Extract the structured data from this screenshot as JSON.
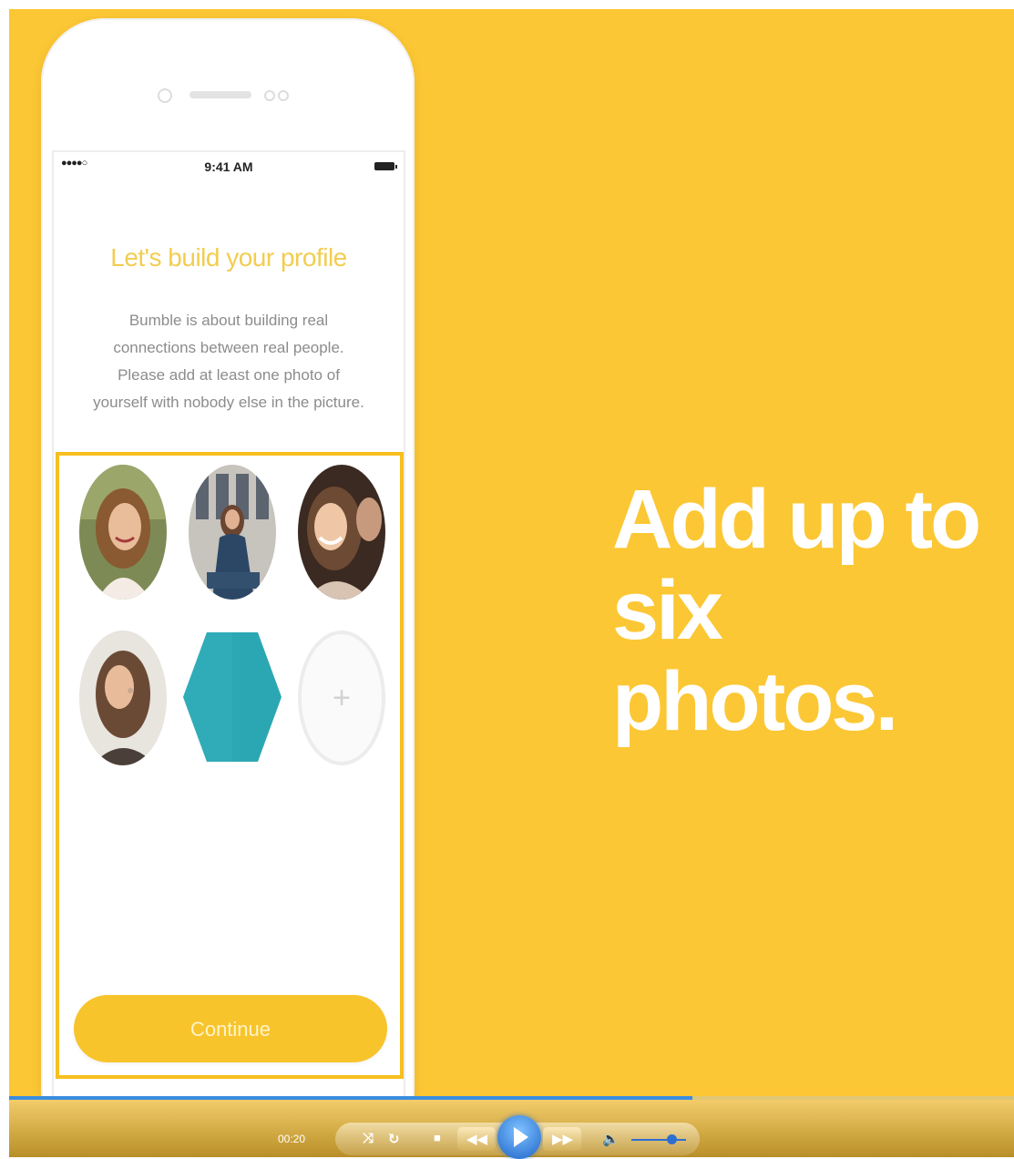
{
  "status_bar": {
    "signal": "●●●●○",
    "time": "9:41 AM"
  },
  "profile": {
    "title": "Let's build your profile",
    "description": "Bumble is about building real connections between real people. Please add at least one photo of yourself with nobody else in the picture."
  },
  "photos": {
    "add_symbol": "+",
    "accent_color": "#2ba7b3"
  },
  "continue_label": "Continue",
  "headline": {
    "line1": "Add up to",
    "line2": "six photos."
  },
  "player": {
    "elapsed": "00:20",
    "progress": 0.68,
    "icons": [
      "shuffle-icon",
      "repeat-icon",
      "stop-icon",
      "rewind-icon",
      "play-icon",
      "fast-forward-icon",
      "volume-icon"
    ]
  },
  "colors": {
    "background": "#fcc734",
    "button": "#f8c42c",
    "title": "#f2cd50",
    "highlight_border": "#f6bf1f"
  }
}
